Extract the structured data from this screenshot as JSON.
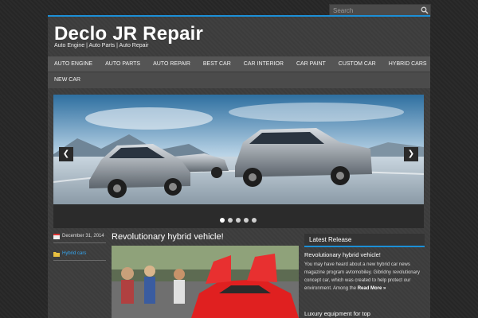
{
  "search": {
    "placeholder": "Search"
  },
  "site": {
    "title": "Declo JR Repair",
    "tagline": "Auto Engine | Auto Parts | Auto Repair"
  },
  "nav": {
    "row1": [
      "AUTO ENGINE",
      "AUTO PARTS",
      "AUTO REPAIR",
      "BEST CAR",
      "CAR INTERIOR",
      "CAR PAINT",
      "CUSTOM CAR",
      "HYBRID CARS"
    ],
    "row2": [
      "NEW CAR"
    ]
  },
  "slider": {
    "prev_label": "❮",
    "next_label": "❯",
    "dot_count": 5,
    "active_dot": 0
  },
  "post": {
    "date": "December 31, 2014",
    "category": "Hybrid cars",
    "title": "Revolutionary hybrid vehicle!"
  },
  "sidebar": {
    "widget_title": "Latest Release",
    "item1_title": "Revolutionary hybrid vehicle!",
    "item1_excerpt": "You may have heard about a new hybrid car news magazine program avtomobiley. Gibridny revolutionary concept car, which was created to help protect our environment.  Among the",
    "read_more": "Read More »",
    "item2_title": "Luxury equipment for top"
  },
  "colors": {
    "accent": "#1c8fd6",
    "link": "#35a5ef",
    "background": "#262626",
    "panel": "#3c3c3c"
  }
}
